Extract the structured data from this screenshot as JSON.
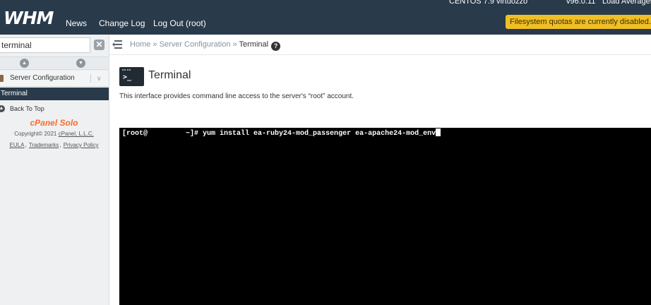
{
  "header": {
    "logo": "WHM",
    "nav": [
      "News",
      "Change Log",
      "Log Out (root)"
    ],
    "os": "CENTOS 7.9 virtuozzo",
    "version": "v96.0.11",
    "load_label": "Load Averages",
    "quota_warning": "Filesystem quotas are currently disabled."
  },
  "sidebar": {
    "search_value": "terminal",
    "category": "Server Configuration",
    "active_item": "Terminal",
    "back_to_top": "Back To Top",
    "brand": "cPanel Solo",
    "copyright_prefix": "Copyright© 2021 ",
    "copyright_link": "cPanel, L.L.C.",
    "links": [
      "EULA",
      "Trademarks",
      "Privacy Policy"
    ]
  },
  "breadcrumb": {
    "home": "Home",
    "section": "Server Configuration",
    "current": "Terminal",
    "separator": "»"
  },
  "page": {
    "title": "Terminal",
    "icon_prompt": ">_",
    "description": "This interface provides command line access to the server's “root” account."
  },
  "terminal": {
    "prompt": "[root@         ~]# ",
    "command": "yum install ea-ruby24-mod_passenger ea-apache24-mod_env"
  },
  "colors": {
    "header_bg": "#293a4a",
    "warning_bg": "#f0bf24",
    "brand_orange": "#ff6c2c",
    "terminal_bg": "#000000"
  }
}
